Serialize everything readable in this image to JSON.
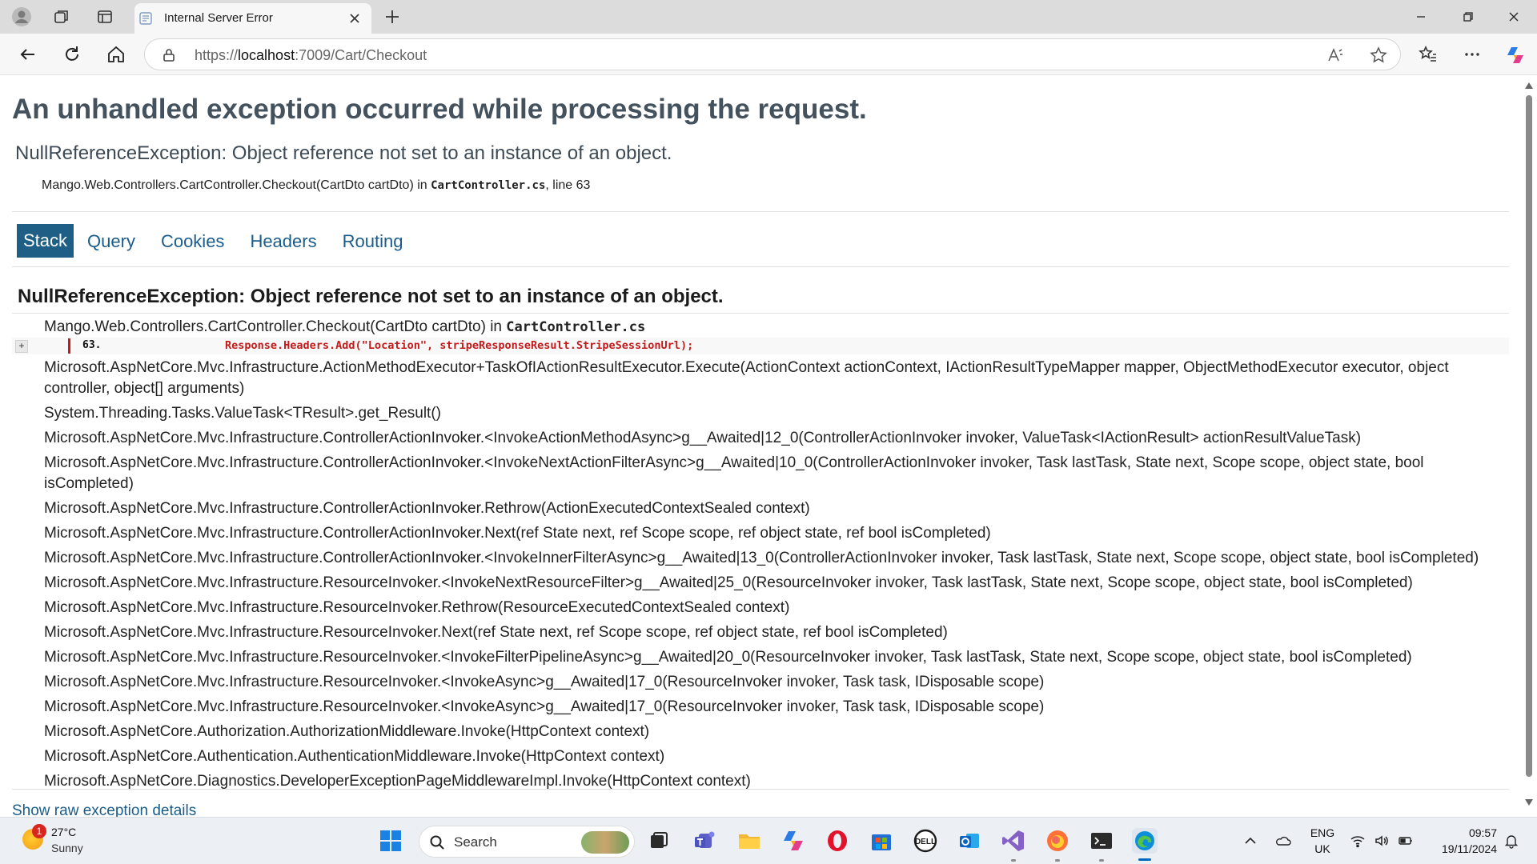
{
  "browser": {
    "tab_title": "Internal Server Error",
    "url_prefix": "https://",
    "url_host": "localhost",
    "url_rest": ":7009/Cart/Checkout"
  },
  "page": {
    "title": "An unhandled exception occurred while processing the request.",
    "exception_summary": "NullReferenceException: Object reference not set to an instance of an object.",
    "location_method": "Mango.Web.Controllers.CartController.Checkout(CartDto cartDto) in ",
    "location_file": "CartController.cs",
    "location_line": ", line 63",
    "tabs": [
      "Stack",
      "Query",
      "Cookies",
      "Headers",
      "Routing"
    ],
    "stack_title": "NullReferenceException: Object reference not set to an instance of an object.",
    "first_frame_method": "Mango.Web.Controllers.CartController.Checkout(CartDto cartDto) in ",
    "first_frame_file": "CartController.cs",
    "code_expand": "+",
    "code_line_number": "63.",
    "code_line": "Response.Headers.Add(\"Location\", stripeResponseResult.StripeSessionUrl);",
    "frames": [
      "Microsoft.AspNetCore.Mvc.Infrastructure.ActionMethodExecutor+TaskOfIActionResultExecutor.Execute(ActionContext actionContext, IActionResultTypeMapper mapper, ObjectMethodExecutor executor, object controller, object[] arguments)",
      "System.Threading.Tasks.ValueTask<TResult>.get_Result()",
      "Microsoft.AspNetCore.Mvc.Infrastructure.ControllerActionInvoker.<InvokeActionMethodAsync>g__Awaited|12_0(ControllerActionInvoker invoker, ValueTask<IActionResult> actionResultValueTask)",
      "Microsoft.AspNetCore.Mvc.Infrastructure.ControllerActionInvoker.<InvokeNextActionFilterAsync>g__Awaited|10_0(ControllerActionInvoker invoker, Task lastTask, State next, Scope scope, object state, bool isCompleted)",
      "Microsoft.AspNetCore.Mvc.Infrastructure.ControllerActionInvoker.Rethrow(ActionExecutedContextSealed context)",
      "Microsoft.AspNetCore.Mvc.Infrastructure.ControllerActionInvoker.Next(ref State next, ref Scope scope, ref object state, ref bool isCompleted)",
      "Microsoft.AspNetCore.Mvc.Infrastructure.ControllerActionInvoker.<InvokeInnerFilterAsync>g__Awaited|13_0(ControllerActionInvoker invoker, Task lastTask, State next, Scope scope, object state, bool isCompleted)",
      "Microsoft.AspNetCore.Mvc.Infrastructure.ResourceInvoker.<InvokeNextResourceFilter>g__Awaited|25_0(ResourceInvoker invoker, Task lastTask, State next, Scope scope, object state, bool isCompleted)",
      "Microsoft.AspNetCore.Mvc.Infrastructure.ResourceInvoker.Rethrow(ResourceExecutedContextSealed context)",
      "Microsoft.AspNetCore.Mvc.Infrastructure.ResourceInvoker.Next(ref State next, ref Scope scope, ref object state, ref bool isCompleted)",
      "Microsoft.AspNetCore.Mvc.Infrastructure.ResourceInvoker.<InvokeFilterPipelineAsync>g__Awaited|20_0(ResourceInvoker invoker, Task lastTask, State next, Scope scope, object state, bool isCompleted)",
      "Microsoft.AspNetCore.Mvc.Infrastructure.ResourceInvoker.<InvokeAsync>g__Awaited|17_0(ResourceInvoker invoker, Task task, IDisposable scope)",
      "Microsoft.AspNetCore.Mvc.Infrastructure.ResourceInvoker.<InvokeAsync>g__Awaited|17_0(ResourceInvoker invoker, Task task, IDisposable scope)",
      "Microsoft.AspNetCore.Authorization.AuthorizationMiddleware.Invoke(HttpContext context)",
      "Microsoft.AspNetCore.Authentication.AuthenticationMiddleware.Invoke(HttpContext context)",
      "Microsoft.AspNetCore.Diagnostics.DeveloperExceptionPageMiddlewareImpl.Invoke(HttpContext context)"
    ],
    "raw_link": "Show raw exception details"
  },
  "taskbar": {
    "weather_badge": "1",
    "temperature": "27°C",
    "condition": "Sunny",
    "search_label": "Search",
    "lang_1": "ENG",
    "lang_2": "UK",
    "time": "09:57",
    "date": "19/11/2024",
    "icons": [
      "start-icon",
      "search-icon",
      "task-view-icon",
      "teams-icon",
      "file-explorer-icon",
      "copilot-icon",
      "opera-icon",
      "microsoft-store-icon",
      "dell-icon",
      "outlook-icon",
      "visual-studio-icon",
      "firefox-icon",
      "terminal-icon",
      "edge-icon"
    ]
  },
  "colors": {
    "accent_tab": "#1f5f85",
    "link": "#1a5c8a",
    "error_code": "#c41a1a",
    "title": "#44525e"
  }
}
